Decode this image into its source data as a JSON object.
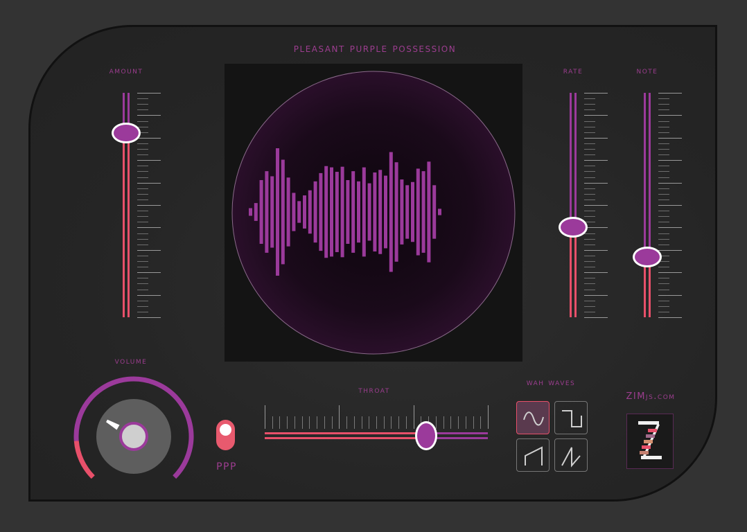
{
  "app": {
    "title": "Pleasant Purple Possession"
  },
  "sliders": {
    "amount": {
      "label": "AMOUNT",
      "value": 0.82
    },
    "rate": {
      "label": "RATE",
      "value": 0.4
    },
    "note": {
      "label": "NOTE",
      "value": 0.27
    }
  },
  "volume": {
    "label": "VOLUME",
    "value": 0.15
  },
  "toggle": {
    "label": "PPP",
    "on": true
  },
  "throat": {
    "label": "THROAT",
    "value": 0.72
  },
  "wah_waves": {
    "label": "WAH WAVES",
    "options": [
      "sine",
      "square",
      "sawtooth",
      "reverse-sawtooth"
    ],
    "selected": "sine"
  },
  "brand": {
    "site": "ZIMjs.com",
    "logo_icon": "zim-z-logo-icon"
  },
  "visualizer": {
    "bars": [
      0.06,
      0.14,
      0.5,
      0.64,
      0.56,
      1.0,
      0.82,
      0.54,
      0.3,
      0.17,
      0.26,
      0.34,
      0.48,
      0.61,
      0.72,
      0.7,
      0.63,
      0.71,
      0.5,
      0.64,
      0.48,
      0.7,
      0.45,
      0.62,
      0.66,
      0.57,
      0.94,
      0.78,
      0.51,
      0.42,
      0.47,
      0.68,
      0.64,
      0.79,
      0.42,
      0.05
    ]
  },
  "colors": {
    "accent": "#9b3a9b",
    "active": "#e8506a",
    "label": "#9c3d8f",
    "knob": "#5e5e5e",
    "panel": "#262626"
  }
}
